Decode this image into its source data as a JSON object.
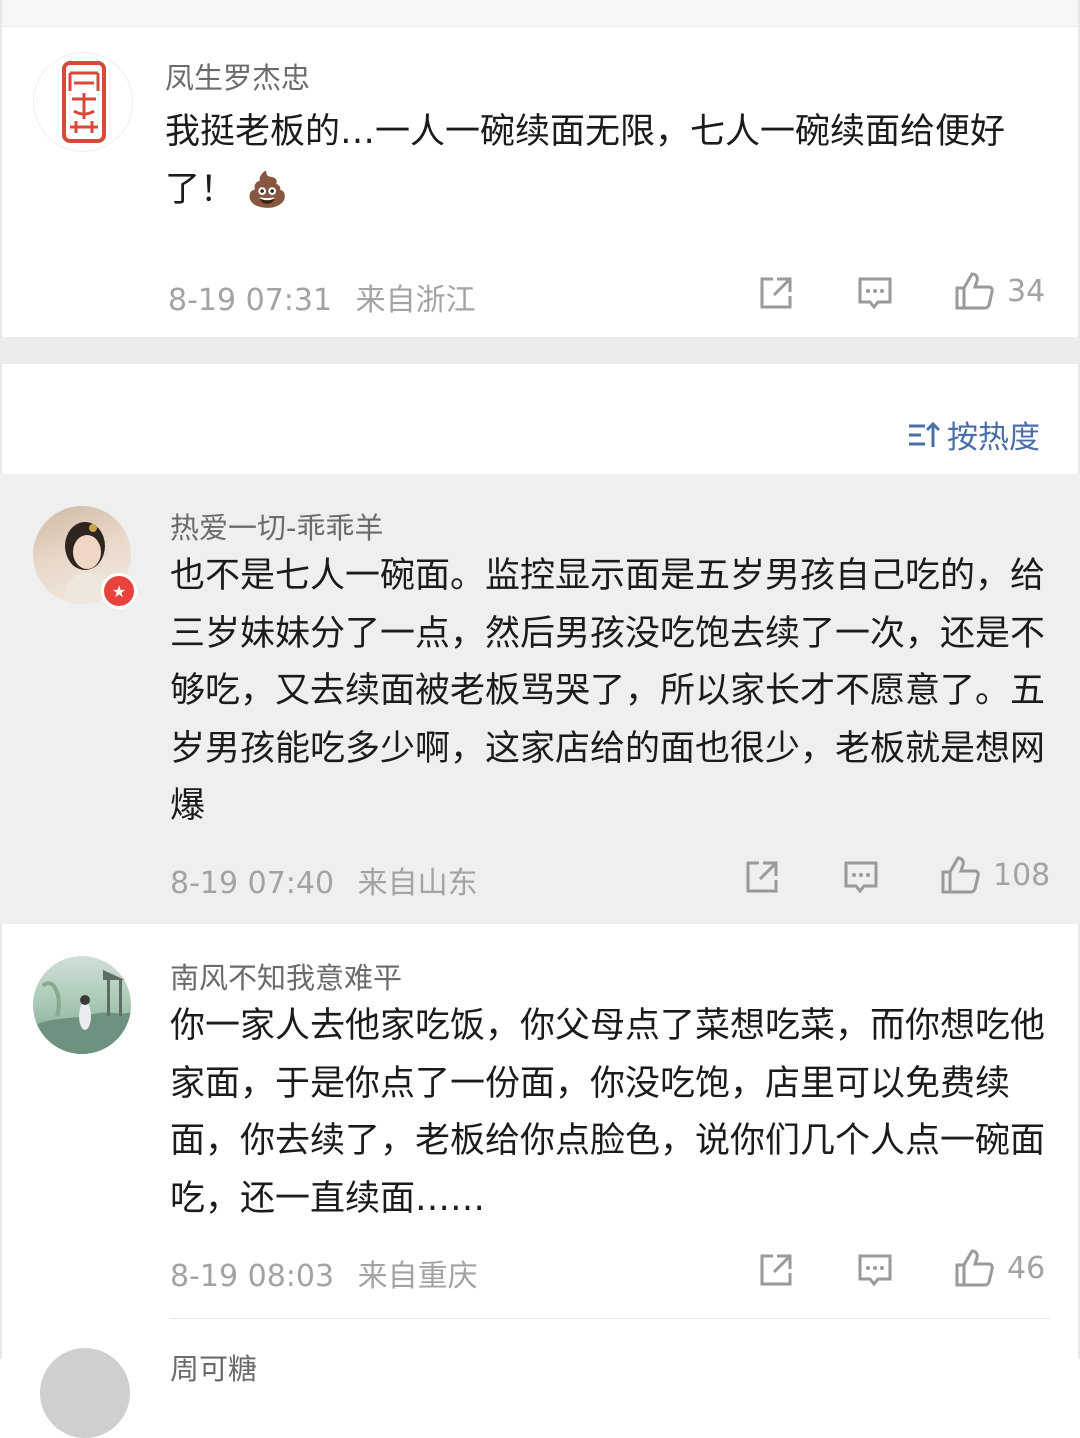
{
  "sort": {
    "label": "按热度",
    "icon": "sort-icon"
  },
  "comments": [
    {
      "username": "凤生罗杰忠",
      "text": "我挺老板的…一人一碗续面无限，七人一碗续面给便好了！",
      "emoji": "💩",
      "date": "8-19 07:31",
      "location": "来自浙江",
      "likes": "34"
    },
    {
      "username": "热爱一切-乖乖羊",
      "text": "也不是七人一碗面。监控显示面是五岁男孩自己吃的，给三岁妹妹分了一点，然后男孩没吃饱去续了一次，还是不够吃，又去续面被老板骂哭了，所以家长才不愿意了。五岁男孩能吃多少啊，这家店给的面也很少，老板就是想网爆",
      "date": "8-19 07:40",
      "location": "来自山东",
      "likes": "108"
    },
    {
      "username": "南风不知我意难平",
      "text": "你一家人去他家吃饭，你父母点了菜想吃菜，而你想吃他家面，于是你点了一份面，你没吃饱，店里可以免费续面，你去续了，老板给你点脸色，说你们几个人点一碗面吃，还一直续面……",
      "date": "8-19 08:03",
      "location": "来自重庆",
      "likes": "46"
    },
    {
      "username": "周可糖"
    }
  ],
  "icons": {
    "share": "share-icon",
    "reply": "comment-icon",
    "like": "thumbs-up-icon"
  },
  "colors": {
    "link": "#4a6fa8",
    "meta": "#a3a3a3",
    "highlight": "#efefef",
    "badge": "#e8433b"
  }
}
